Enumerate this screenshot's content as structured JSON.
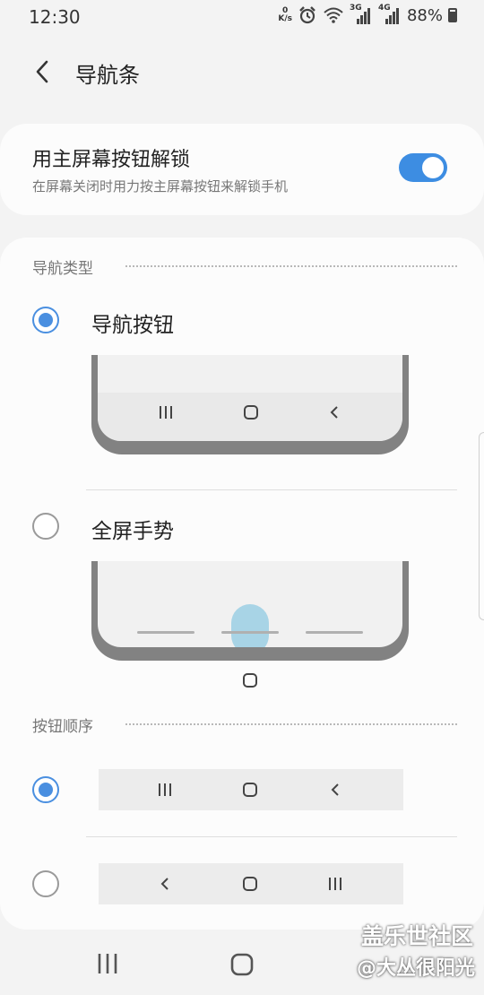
{
  "status_bar": {
    "time": "12:30",
    "net_speed_value": "0",
    "net_speed_unit": "K/s",
    "network_label_1": "3G",
    "network_label_2": "4G",
    "battery": "88%"
  },
  "header": {
    "title": "导航条"
  },
  "home_button_unlock": {
    "title": "用主屏幕按钮解锁",
    "subtitle": "在屏幕关闭时用力按主屏幕按钮来解锁手机",
    "enabled": true
  },
  "navigation_type": {
    "section_label": "导航类型",
    "options": [
      {
        "label": "导航按钮",
        "selected": true
      },
      {
        "label": "全屏手势",
        "selected": false
      }
    ]
  },
  "button_order": {
    "section_label": "按钮顺序",
    "options": [
      {
        "order": [
          "recents",
          "home",
          "back"
        ],
        "selected": true
      },
      {
        "order": [
          "back",
          "home",
          "recents"
        ],
        "selected": false
      }
    ]
  },
  "watermark": {
    "line1": "盖乐世社区",
    "line2": "@大丛很阳光"
  },
  "colors": {
    "accent": "#4a8fe0",
    "toggle_on": "#3d8de2",
    "gesture_hint": "#a8d4e6"
  }
}
